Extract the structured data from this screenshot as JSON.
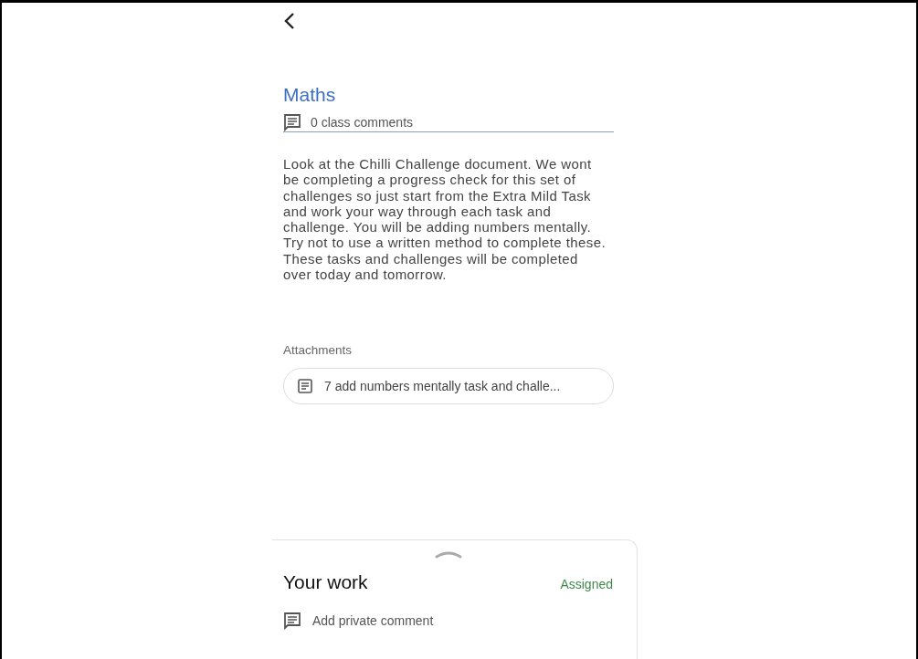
{
  "title": "Maths",
  "class_comments": "0 class comments",
  "description": "Look at the Chilli Challenge document. We wont be completing a progress check for this set of challenges so just start from the Extra Mild Task and work your way through each task and challenge. You will be adding numbers mentally. Try not to use a written method to complete these. These tasks and challenges will be completed over today and tomorrow.",
  "attachments_label": "Attachments",
  "attachments": [
    {
      "name": "7 add numbers mentally task and challe..."
    }
  ],
  "your_work": {
    "title": "Your work",
    "status": "Assigned",
    "private_comment": "Add private comment"
  }
}
